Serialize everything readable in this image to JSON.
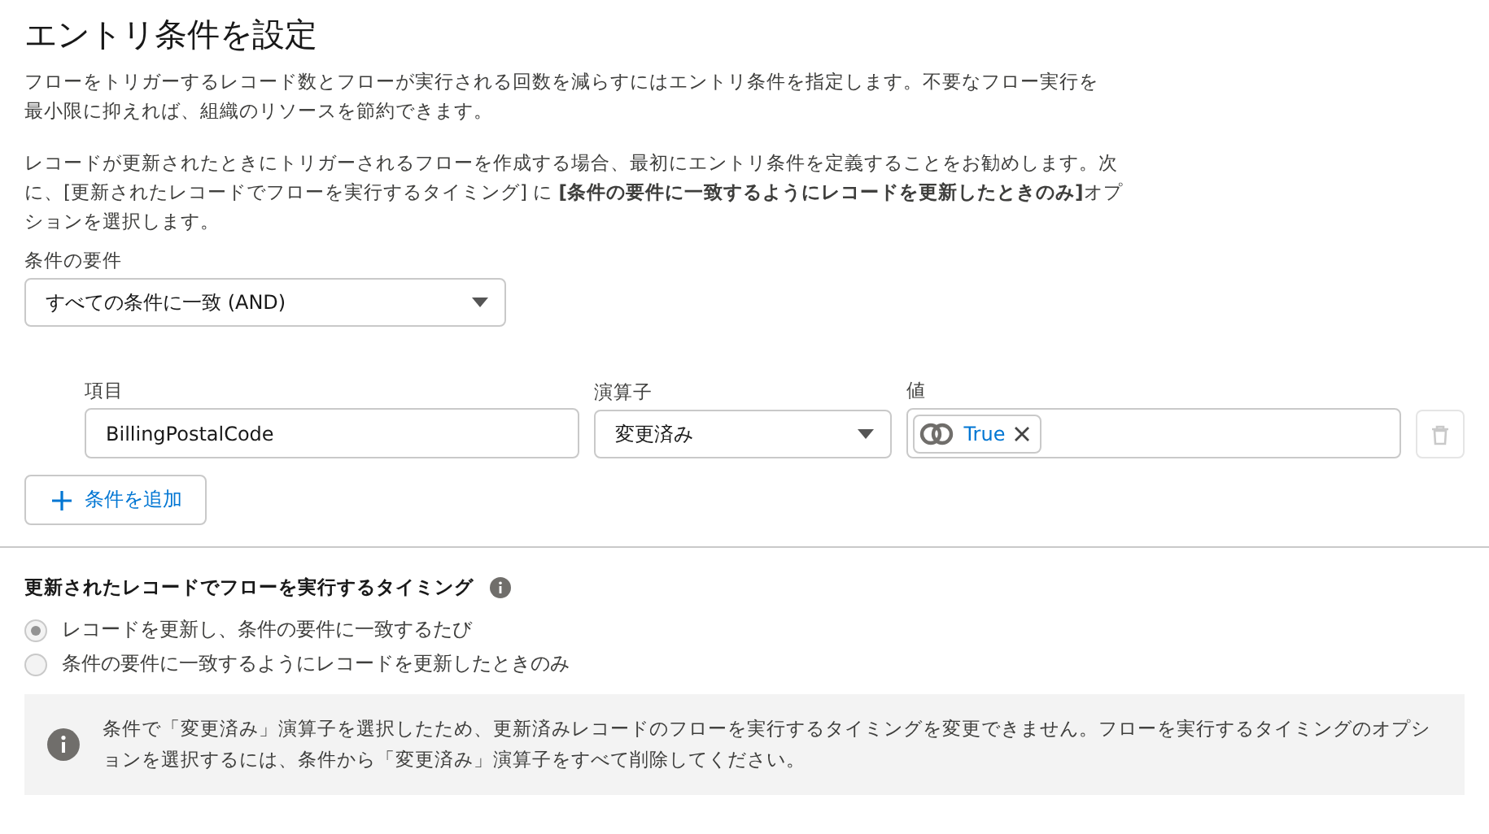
{
  "title": "エントリ条件を設定",
  "paragraphs": [
    "フローをトリガーするレコード数とフローが実行される回数を減らすにはエントリ条件を指定します。不要なフロー実行を最小限に抑えれば、組織のリソースを節約できます。",
    "レコードが更新されたときにトリガーされるフローを作成する場合、最初にエントリ条件を定義することをお勧めします。次に、[更新されたレコードでフローを実行するタイミング] に **[条件の要件に一致するようにレコードを更新したときのみ]**オプションを選択します。"
  ],
  "requirement": {
    "label": "条件の要件",
    "value": "すべての条件に一致 (AND)"
  },
  "condition": {
    "field_label": "項目",
    "field_value": "BillingPostalCode",
    "operator_label": "演算子",
    "operator_value": "変更済み",
    "value_label": "値",
    "value_pill": "True",
    "delete_disabled": true
  },
  "add_button": "条件を追加",
  "timing": {
    "heading": "更新されたレコードでフローを実行するタイミング",
    "options": [
      {
        "label": "レコードを更新し、条件の要件に一致するたび",
        "selected": true,
        "disabled": true
      },
      {
        "label": "条件の要件に一致するようにレコードを更新したときのみ",
        "selected": false,
        "disabled": true
      }
    ]
  },
  "info": "条件で「変更済み」演算子を選択したため、更新済みレコードのフローを実行するタイミングを変更できません。フローを実行するタイミングのオプションを選択するには、条件から「変更済み」演算子をすべて削除してください。"
}
